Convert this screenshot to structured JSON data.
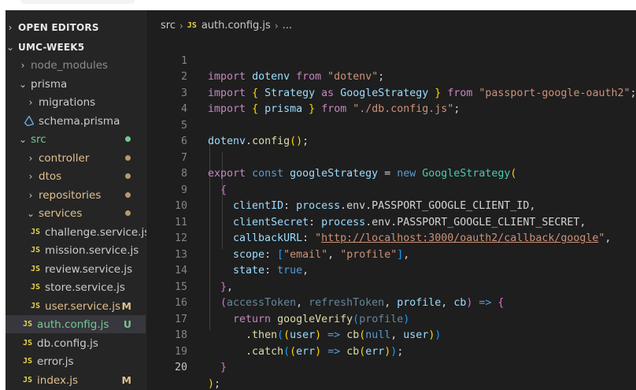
{
  "sidebar": {
    "open_editors": "OPEN EDITORS",
    "project": "UMC-WEEK5",
    "items": {
      "node_modules": "node_modules",
      "prisma": "prisma",
      "migrations": "migrations",
      "schema": "schema.prisma",
      "src": "src",
      "controller": "controller",
      "dtos": "dtos",
      "repositories": "repositories",
      "services": "services",
      "challenge": "challenge.service.js",
      "mission": "mission.service.js",
      "review": "review.service.js",
      "store": "store.service.js",
      "user": "user.service.js",
      "auth": "auth.config.js",
      "db": "db.config.js",
      "error": "error.js",
      "index": "index.js"
    },
    "badges": {
      "modified": "M",
      "untracked": "U"
    },
    "file_icon": "JS"
  },
  "breadcrumb": {
    "folder": "src",
    "file": "auth.config.js",
    "more": "..."
  },
  "code": {
    "line_numbers": [
      "1",
      "2",
      "3",
      "4",
      "5",
      "6",
      "7",
      "8",
      "9",
      "10",
      "11",
      "12",
      "13",
      "14",
      "15",
      "16",
      "17",
      "18",
      "19",
      "20"
    ],
    "tokens": {
      "import": "import",
      "from": "from",
      "as": "as",
      "dotenv": "dotenv",
      "dotenv_str": "\"dotenv\"",
      "lb": "{",
      "rb": "}",
      "strategy": "Strategy",
      "google_strategy": "GoogleStrategy",
      "passport_str": "\"passport-google-oauth2\"",
      "prisma": "prisma",
      "db_str": "\"./db.config.js\"",
      "semi": ";",
      "config": "config",
      "parens": "()",
      "export": "export",
      "const": "const",
      "google_strategy_var": "googleStrategy",
      "eq": "=",
      "new": "new",
      "lp": "(",
      "rp": ")",
      "client_id": "clientID",
      "client_secret": "clientSecret",
      "callback_url": "callbackURL",
      "scope": "scope",
      "state": "state",
      "colon": ":",
      "comma": ",",
      "process": "process",
      "env_client_id": ".env.PASSPORT_GOOGLE_CLIENT_ID,",
      "env_client_secret": ".env.PASSPORT_GOOGLE_CLIENT_SECRET,",
      "q": "\"",
      "callback_link": "http://localhost:3000/oauth2/callback/google",
      "lbr": "[",
      "rbr": "]",
      "email_str": "\"email\"",
      "profile_str": "\"profile\"",
      "true": "true",
      "access_token": "accessToken",
      "refresh_token": "refreshToken",
      "profile": "profile",
      "cb": "cb",
      "arrow": "=>",
      "return": "return",
      "google_verify": "googleVerify",
      "then": ".then",
      "user": "user",
      "null": "null",
      "catch": ".catch",
      "err": "err"
    }
  },
  "colors": {
    "modified": "#e2c08d",
    "untracked": "#73c991",
    "accent": "#37373d"
  },
  "icons": [
    "chevron-right-icon",
    "chevron-down-icon",
    "js-file-icon",
    "prisma-file-icon",
    "git-dot-icon"
  ]
}
